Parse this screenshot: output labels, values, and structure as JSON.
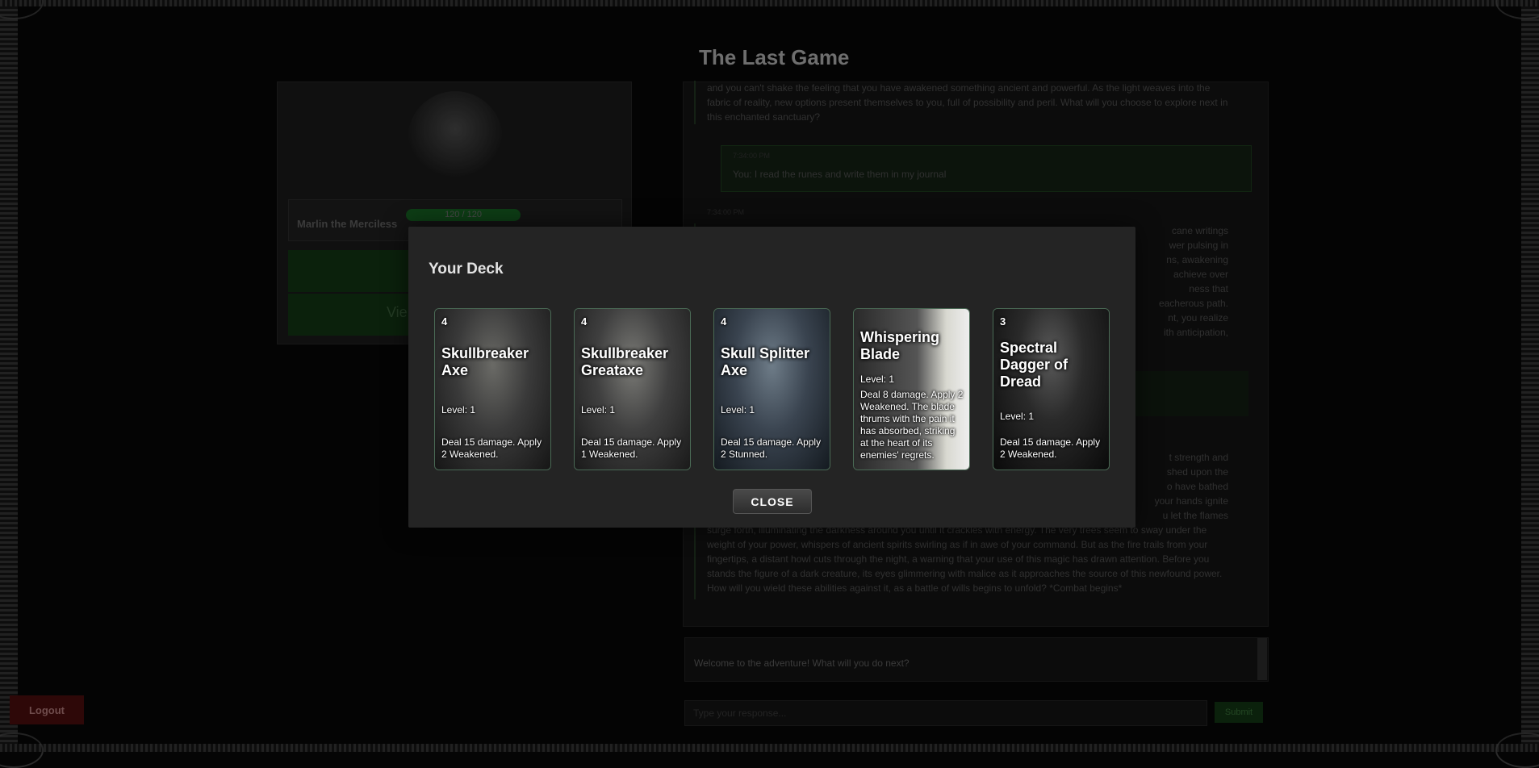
{
  "app": {
    "title": "The Last Game"
  },
  "character": {
    "name": "Marlin the Merciless",
    "hp_text": "120 / 120",
    "hp_fraction": 1.0,
    "view_button": "Vie"
  },
  "story": {
    "block1": "and you can't shake the feeling that you have awakened something ancient and powerful. As the light weaves into the fabric of reality, new options present themselves to you, full of possibility and peril. What will you choose to explore next in this enchanted sanctuary?",
    "player_time": "7:34:00 PM",
    "player_text": "You: I read the runes and write them in my journal",
    "block2_time": "7:34:00 PM",
    "block2_fragments": [
      "cane writings",
      "wer pulsing in",
      "ns, awakening",
      "achieve over",
      "ness that",
      "eacherous path.",
      "nt, you realize",
      "ith anticipation,"
    ],
    "block3_fragments": [
      "t strength and",
      "shed upon the",
      "o have bathed",
      "your hands ignite",
      "u let the flames"
    ],
    "block3": "surge forth, illuminating the darkness around you until it crackles with energy. The very trees seem to sway under the weight of your power, whispers of ancient spirits swirling as if in awe of your command. But as the fire trails from your fingertips, a distant howl cuts through the night, a warning that your use of this magic has drawn attention. Before you stands the figure of a dark creature, its eyes glimmering with malice as it approaches the source of this newfound power. How will you wield these abilities against it, as a battle of wills begins to unfold? *Combat begins*"
  },
  "notice": {
    "text": "Welcome to the adventure! What will you do next?"
  },
  "input": {
    "placeholder": "Type your response...",
    "submit_label": "Submit"
  },
  "logout_label": "Logout",
  "deck": {
    "title": "Your Deck",
    "close_label": "CLOSE",
    "cards": [
      {
        "cost": "4",
        "name": "Skullbreaker Axe",
        "level": "Level: 1",
        "description": "Deal 15 damage. Apply 2 Weakened."
      },
      {
        "cost": "4",
        "name": "Skullbreaker Greataxe",
        "level": "Level: 1",
        "description": "Deal 15 damage. Apply 1 Weakened."
      },
      {
        "cost": "4",
        "name": "Skull Splitter Axe",
        "level": "Level: 1",
        "description": "Deal 15 damage. Apply 2 Stunned."
      },
      {
        "cost": "",
        "name": "Whispering Blade",
        "level": "Level: 1",
        "description": "Deal 8 damage. Apply 2 Weakened. The blade thrums with the pain it has absorbed, striking at the heart of its enemies' regrets."
      },
      {
        "cost": "3",
        "name": "Spectral Dagger of Dread",
        "level": "Level: 1",
        "description": "Deal 15 damage. Apply 2 Weakened."
      }
    ]
  },
  "colors": {
    "accent_green": "#114d1b",
    "modal_bg": "#242424",
    "card_border": "#4a6a55"
  }
}
